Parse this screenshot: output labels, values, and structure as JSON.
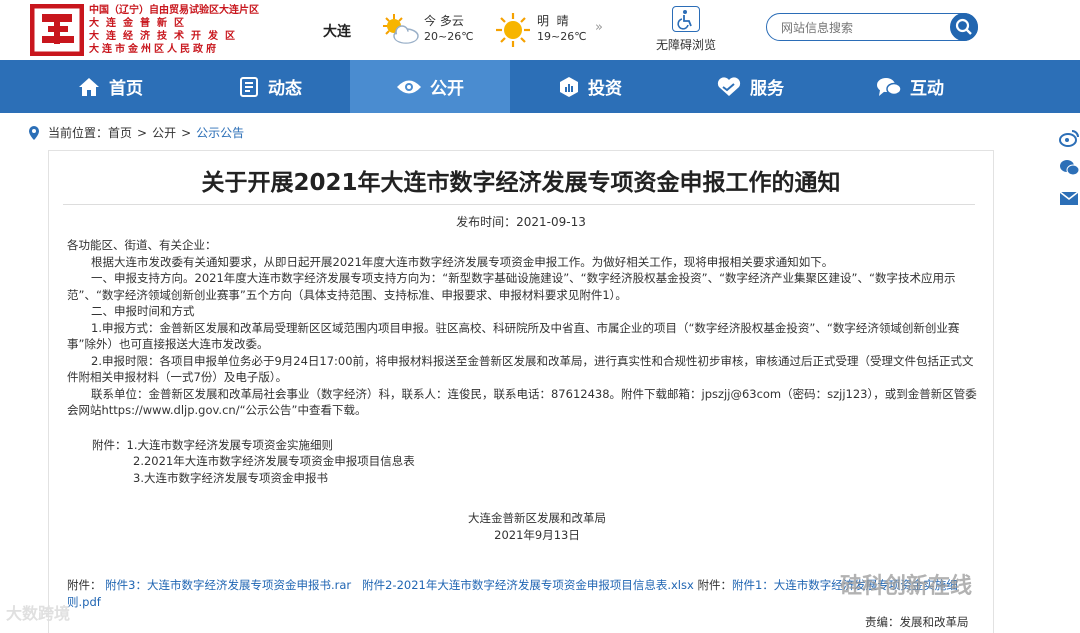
{
  "header": {
    "org_lines": [
      "中国（辽宁）自由贸易试验区大连片区",
      "大连金普新区",
      "大连经济技术开发区",
      "大连市金州区人民政府"
    ],
    "city": "大连",
    "weather": [
      {
        "day": "今",
        "condition": "多云",
        "temp": "20~26℃",
        "icon": "partly-cloudy-icon"
      },
      {
        "day": "明",
        "condition": "晴",
        "temp": "19~26℃",
        "icon": "sun-icon"
      }
    ],
    "more": "»",
    "accessibility_label": "无障碍浏览",
    "search_placeholder": "网站信息搜索",
    "brand_color": "#c8161d",
    "accent_color": "#2c6fb7"
  },
  "nav": {
    "items": [
      {
        "label": "首页",
        "icon": "home-icon"
      },
      {
        "label": "动态",
        "icon": "news-icon"
      },
      {
        "label": "公开",
        "icon": "eye-icon"
      },
      {
        "label": "投资",
        "icon": "chart-icon"
      },
      {
        "label": "服务",
        "icon": "handshake-icon"
      },
      {
        "label": "互动",
        "icon": "chat-icon"
      }
    ],
    "active": 2
  },
  "breadcrumb": {
    "label": "当前位置：",
    "items": [
      "首页",
      "公开",
      "公示公告"
    ],
    "separator": ">"
  },
  "article": {
    "title": "关于开展2021年大连市数字经济发展专项资金申报工作的通知",
    "publish_date": "发布时间：2021-09-13",
    "paragraphs": [
      "各功能区、街道、有关企业：",
      "根据大连市发改委有关通知要求，从即日起开展2021年度大连市数字经济发展专项资金申报工作。为做好相关工作，现将申报相关要求通知如下。",
      "一、申报支持方向。2021年度大连市数字经济发展专项支持方向为：“新型数字基础设施建设”、“数字经济股权基金投资”、“数字经济产业集聚区建设”、“数字技术应用示范”、“数字经济领域创新创业赛事”五个方向（具体支持范围、支持标准、申报要求、申报材料要求见附件1）。",
      "二、申报时间和方式",
      "1.申报方式：金普新区发展和改革局受理新区区域范围内项目申报。驻区高校、科研院所及中省直、市属企业的项目（“数字经济股权基金投资”、“数字经济领域创新创业赛事”除外）也可直接报送大连市发改委。",
      "2.申报时限：各项目申报单位务必于9月24日17:00前，将申报材料报送至金普新区发展和改革局，进行真实性和合规性初步审核，审核通过后正式受理（受理文件包括正式文件附相关申报材料（一式7份）及电子版）。",
      "联系单位：金普新区发展和改革局社会事业（数字经济）科，联系人：连俊民，联系电话：87612438。附件下载邮箱：jpszjj@63com（密码：szjj123），或到金普新区管委会网站https://www.dljp.gov.cn/“公示公告”中查看下载。"
    ],
    "attachments_label": "附件：",
    "attachments": [
      "1.大连市数字经济发展专项资金实施细则",
      "2.2021年大连市数字经济发展专项资金申报项目信息表",
      "3.大连市数字经济发展专项资金申报书"
    ],
    "signature_org": "大连金普新区发展和改革局",
    "signature_date": "2021年9月13日",
    "file_links_label": "附件：",
    "file_links": [
      "附件3：大连市数字经济发展专项资金申报书.rar",
      "附件2-2021年大连市数字经济发展专项资金申报项目信息表.xlsx",
      "附件1：大连市数字经济发展专项资金实施细则.pdf"
    ],
    "editor": "责编：发展和改革局"
  },
  "watermarks": [
    "大数跨境",
    "硅科创新在线"
  ]
}
